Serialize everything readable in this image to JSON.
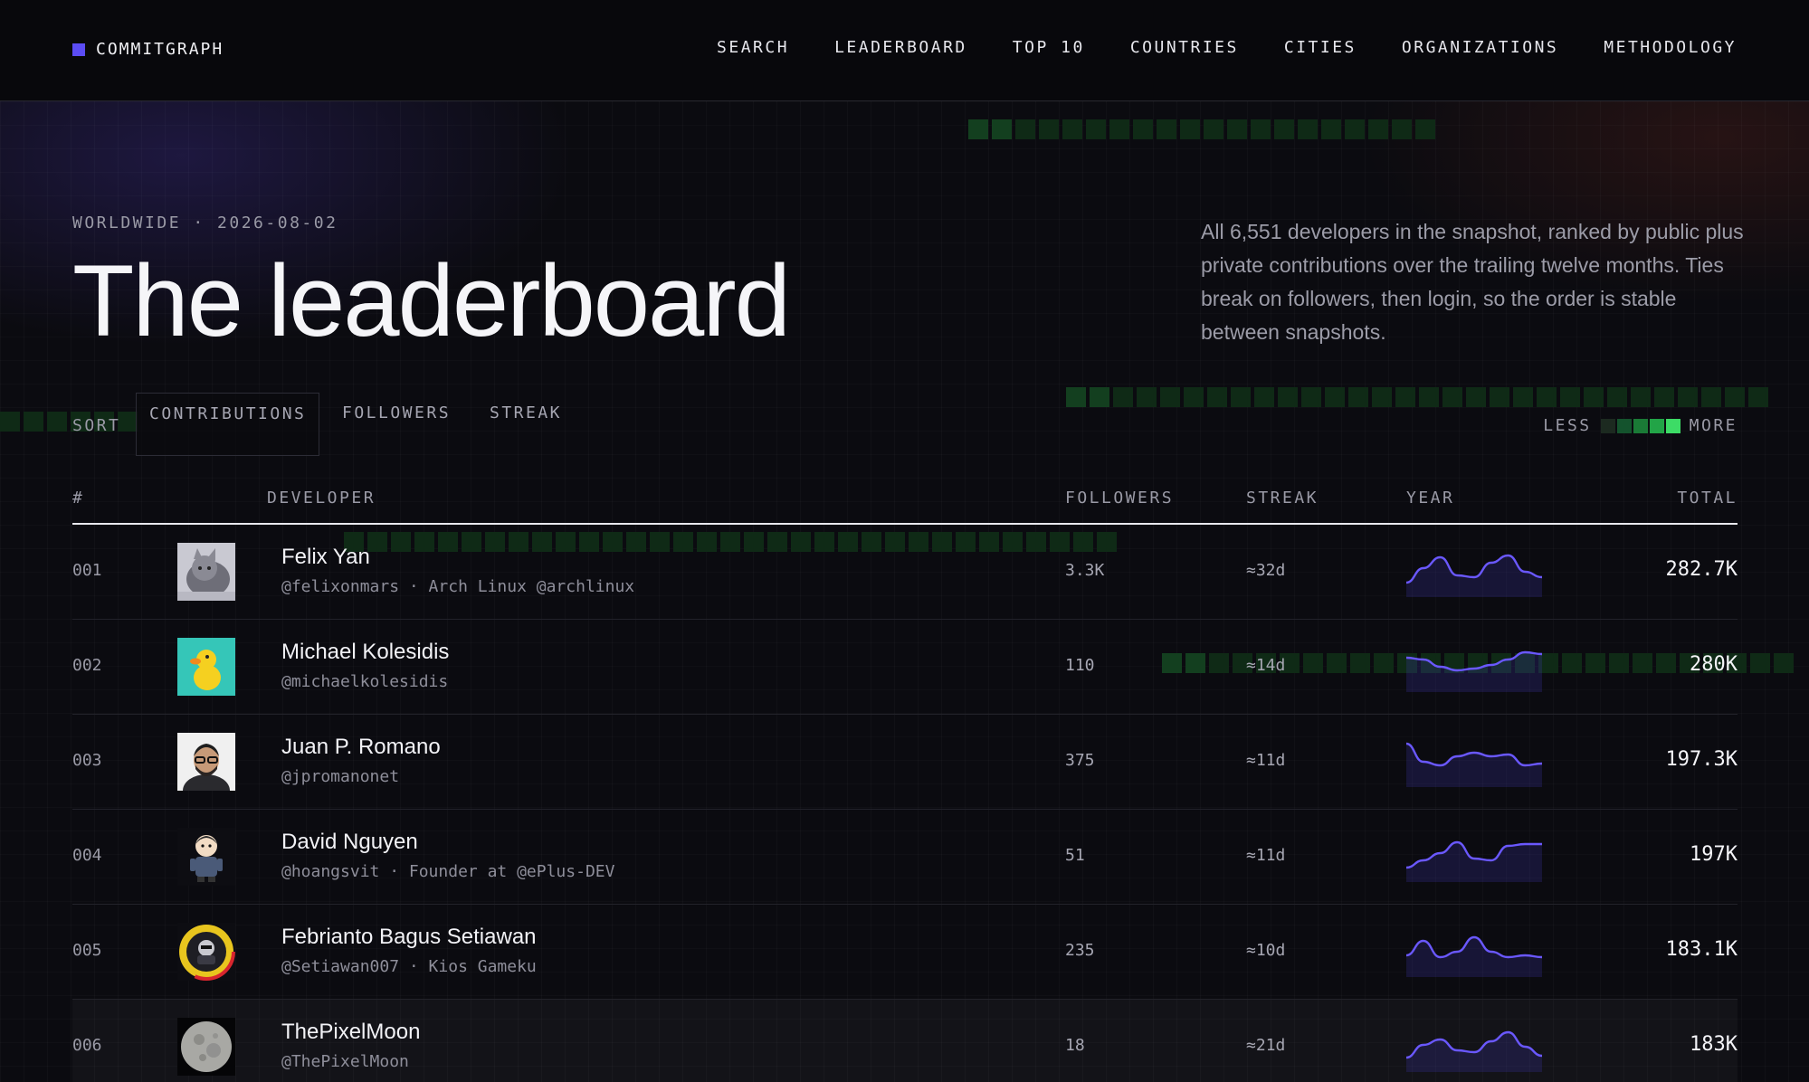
{
  "brand": {
    "name": "COMMITGRAPH"
  },
  "nav": [
    "SEARCH",
    "LEADERBOARD",
    "TOP 10",
    "COUNTRIES",
    "CITIES",
    "ORGANIZATIONS",
    "METHODOLOGY"
  ],
  "hero": {
    "eyebrow": "WORLDWIDE · 2026-08-02",
    "title": "The leaderboard",
    "blurb": "All 6,551 developers in the snapshot, ranked by public plus private contributions over the trailing twelve months. Ties break on followers, then login, so the order is stable between snapshots."
  },
  "sort": {
    "label": "SORT",
    "options": [
      "CONTRIBUTIONS",
      "FOLLOWERS",
      "STREAK"
    ],
    "active": "CONTRIBUTIONS"
  },
  "legend": {
    "less": "LESS",
    "more": "MORE",
    "colors": [
      "#1c2a20",
      "#14532d",
      "#1a7a36",
      "#22a447",
      "#3ddc66"
    ]
  },
  "table": {
    "headers": {
      "rank": "#",
      "developer": "DEVELOPER",
      "followers": "FOLLOWERS",
      "streak": "STREAK",
      "year": "YEAR",
      "total": "TOTAL"
    },
    "rows": [
      {
        "rank": "001",
        "name": "Felix Yan",
        "handle": "@felixonmars · Arch Linux @archlinux",
        "followers": "3.3K",
        "streak": "≈32d",
        "total": "282.7K",
        "avatar": "cat-avatar",
        "spark": [
          0.15,
          0.55,
          0.85,
          0.35,
          0.3,
          0.7,
          0.9,
          0.45,
          0.3
        ]
      },
      {
        "rank": "002",
        "name": "Michael Kolesidis",
        "handle": "@michaelkolesidis",
        "followers": "110",
        "streak": "≈14d",
        "total": "280K",
        "avatar": "duck-avatar",
        "spark": [
          0.7,
          0.65,
          0.45,
          0.35,
          0.4,
          0.5,
          0.65,
          0.85,
          0.8
        ]
      },
      {
        "rank": "003",
        "name": "Juan P. Romano",
        "handle": "@jpromanonet",
        "followers": "375",
        "streak": "≈11d",
        "total": "197.3K",
        "avatar": "portrait-avatar",
        "spark": [
          0.95,
          0.45,
          0.35,
          0.6,
          0.7,
          0.6,
          0.65,
          0.35,
          0.4
        ]
      },
      {
        "rank": "004",
        "name": "David Nguyen",
        "handle": "@hoangsvit · Founder at @ePlus-DEV",
        "followers": "51",
        "streak": "≈11d",
        "total": "197K",
        "avatar": "character-avatar",
        "spark": [
          0.15,
          0.35,
          0.55,
          0.85,
          0.4,
          0.35,
          0.75,
          0.8,
          0.8
        ]
      },
      {
        "rank": "005",
        "name": "Febrianto Bagus Setiawan",
        "handle": "@Setiawan007 · Kios Gameku",
        "followers": "235",
        "streak": "≈10d",
        "total": "183.1K",
        "avatar": "badge-avatar",
        "spark": [
          0.35,
          0.75,
          0.3,
          0.45,
          0.85,
          0.45,
          0.3,
          0.35,
          0.3
        ]
      },
      {
        "rank": "006",
        "name": "ThePixelMoon",
        "handle": "@ThePixelMoon",
        "followers": "18",
        "streak": "≈21d",
        "total": "183K",
        "avatar": "moon-avatar",
        "spark": [
          0.15,
          0.5,
          0.65,
          0.35,
          0.3,
          0.6,
          0.85,
          0.45,
          0.2
        ]
      }
    ]
  }
}
